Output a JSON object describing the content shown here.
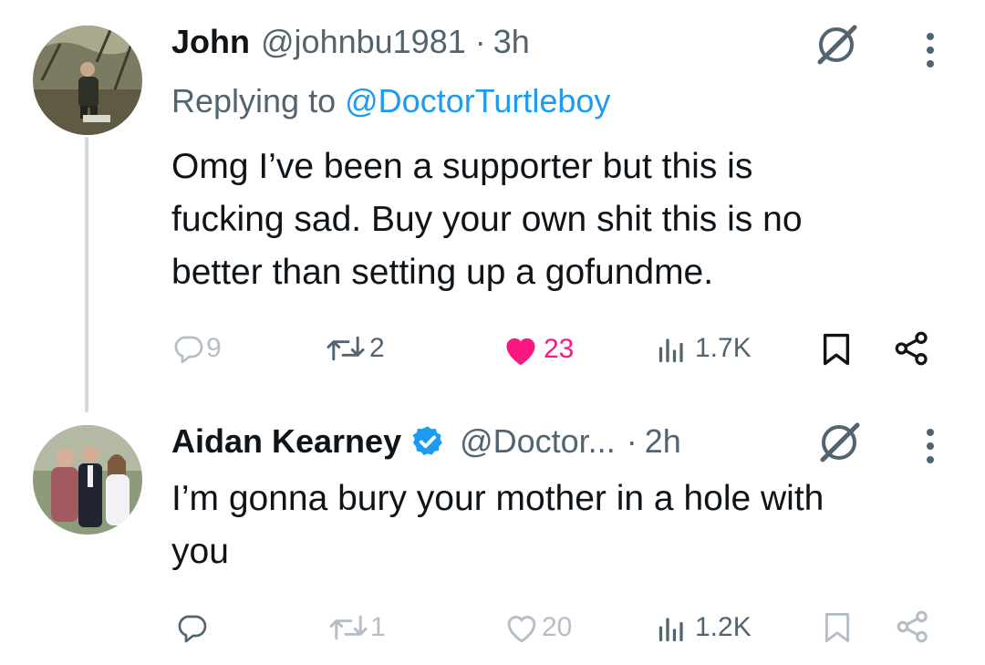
{
  "tweets": [
    {
      "name": "John",
      "handle": "@johnbu1981",
      "separator": "·",
      "time": "3h",
      "replying_prefix": "Replying to",
      "replying_handle": "@DoctorTurtleboy",
      "text": "Omg I’ve been a supporter but this is\nfucking sad.  Buy your own shit this is no\nbetter than setting up a gofundme.",
      "replies": "9",
      "retweets": "2",
      "likes": "23",
      "views": "1.7K",
      "liked": true
    },
    {
      "name": "Aidan Kearney",
      "verified": true,
      "handle": "@Doctor...",
      "separator": "·",
      "time": "2h",
      "text": "I’m gonna bury your mother in a hole with\nyou",
      "replies": "",
      "retweets": "1",
      "likes": "20",
      "views": "1.2K",
      "liked": false
    }
  ],
  "colors": {
    "text": "#0f1419",
    "muted": "#536471",
    "link": "#1d9bf0",
    "like": "#f91880",
    "verified": "#1d9bf0",
    "thread_line": "#cfd9de"
  }
}
